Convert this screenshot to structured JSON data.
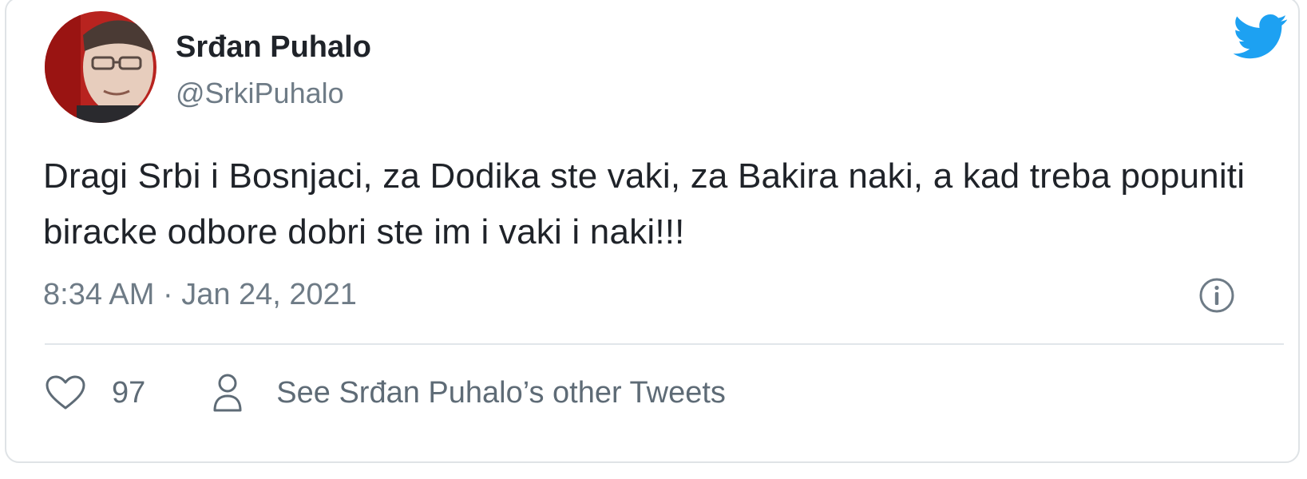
{
  "author": {
    "display_name": "Srđan Puhalo",
    "handle": "@SrkiPuhalo"
  },
  "tweet": {
    "text": "Dragi Srbi i Bosnjaci, za Dodika ste vaki, za Bakira naki, a kad treba popuniti biracke odbore dobri ste im i vaki i naki!!!",
    "timestamp": "8:34 AM · Jan 24, 2021"
  },
  "actions": {
    "like_count": "97",
    "other_tweets_label": "See Srđan Puhalo’s other Tweets"
  },
  "icons": {
    "brand": "twitter-bird-icon",
    "info": "info-icon",
    "like": "heart-icon",
    "profile": "person-icon"
  },
  "colors": {
    "twitter_blue": "#1da1f2",
    "text_primary": "#1f2329",
    "text_secondary": "#6e7b86",
    "divider": "#e1e6ea"
  }
}
